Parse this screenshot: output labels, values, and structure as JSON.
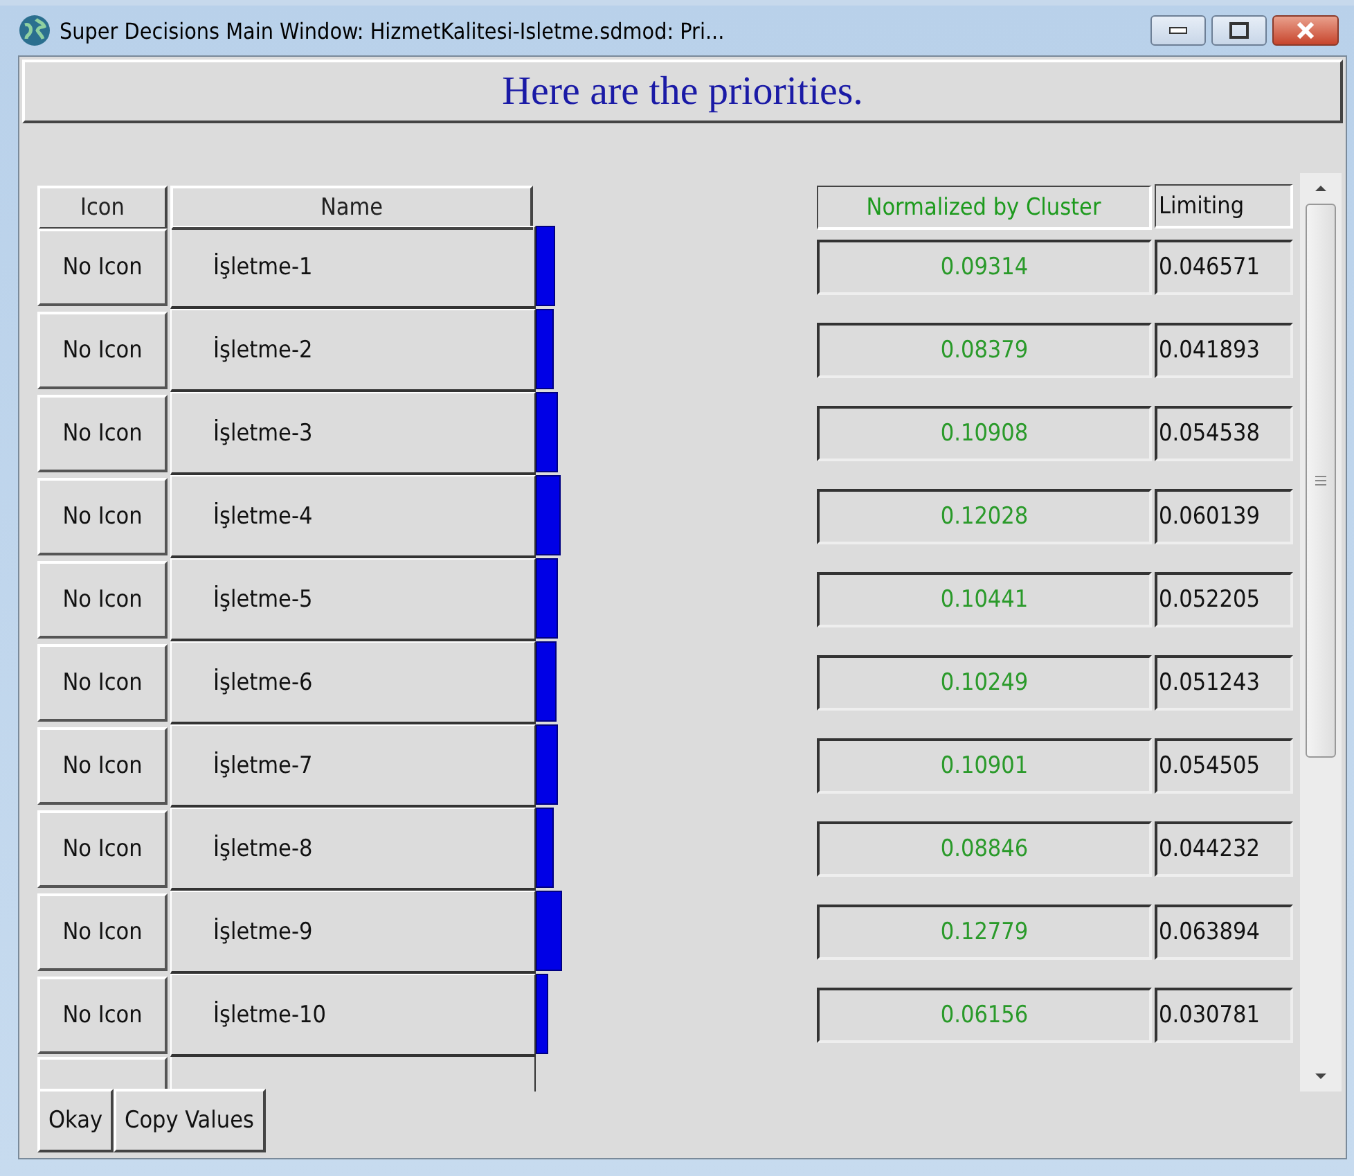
{
  "window": {
    "title": "Super Decisions Main Window: HizmetKalitesi-Isletme.sdmod: Pri..."
  },
  "heading": "Here are the priorities.",
  "table": {
    "columns": [
      "Icon",
      "Name",
      "Normalized by Cluster",
      "Limiting"
    ],
    "rows": [
      {
        "icon": "No Icon",
        "name": "İşletme-1",
        "normalized": "0.09314",
        "limiting": "0.046571"
      },
      {
        "icon": "No Icon",
        "name": "İşletme-2",
        "normalized": "0.08379",
        "limiting": "0.041893"
      },
      {
        "icon": "No Icon",
        "name": "İşletme-3",
        "normalized": "0.10908",
        "limiting": "0.054538"
      },
      {
        "icon": "No Icon",
        "name": "İşletme-4",
        "normalized": "0.12028",
        "limiting": "0.060139"
      },
      {
        "icon": "No Icon",
        "name": "İşletme-5",
        "normalized": "0.10441",
        "limiting": "0.052205"
      },
      {
        "icon": "No Icon",
        "name": "İşletme-6",
        "normalized": "0.10249",
        "limiting": "0.051243"
      },
      {
        "icon": "No Icon",
        "name": "İşletme-7",
        "normalized": "0.10901",
        "limiting": "0.054505"
      },
      {
        "icon": "No Icon",
        "name": "İşletme-8",
        "normalized": "0.08846",
        "limiting": "0.044232"
      },
      {
        "icon": "No Icon",
        "name": "İşletme-9",
        "normalized": "0.12779",
        "limiting": "0.063894"
      },
      {
        "icon": "No Icon",
        "name": "İşletme-10",
        "normalized": "0.06156",
        "limiting": "0.030781"
      }
    ]
  },
  "buttons": [
    "Okay",
    "Copy Values"
  ]
}
